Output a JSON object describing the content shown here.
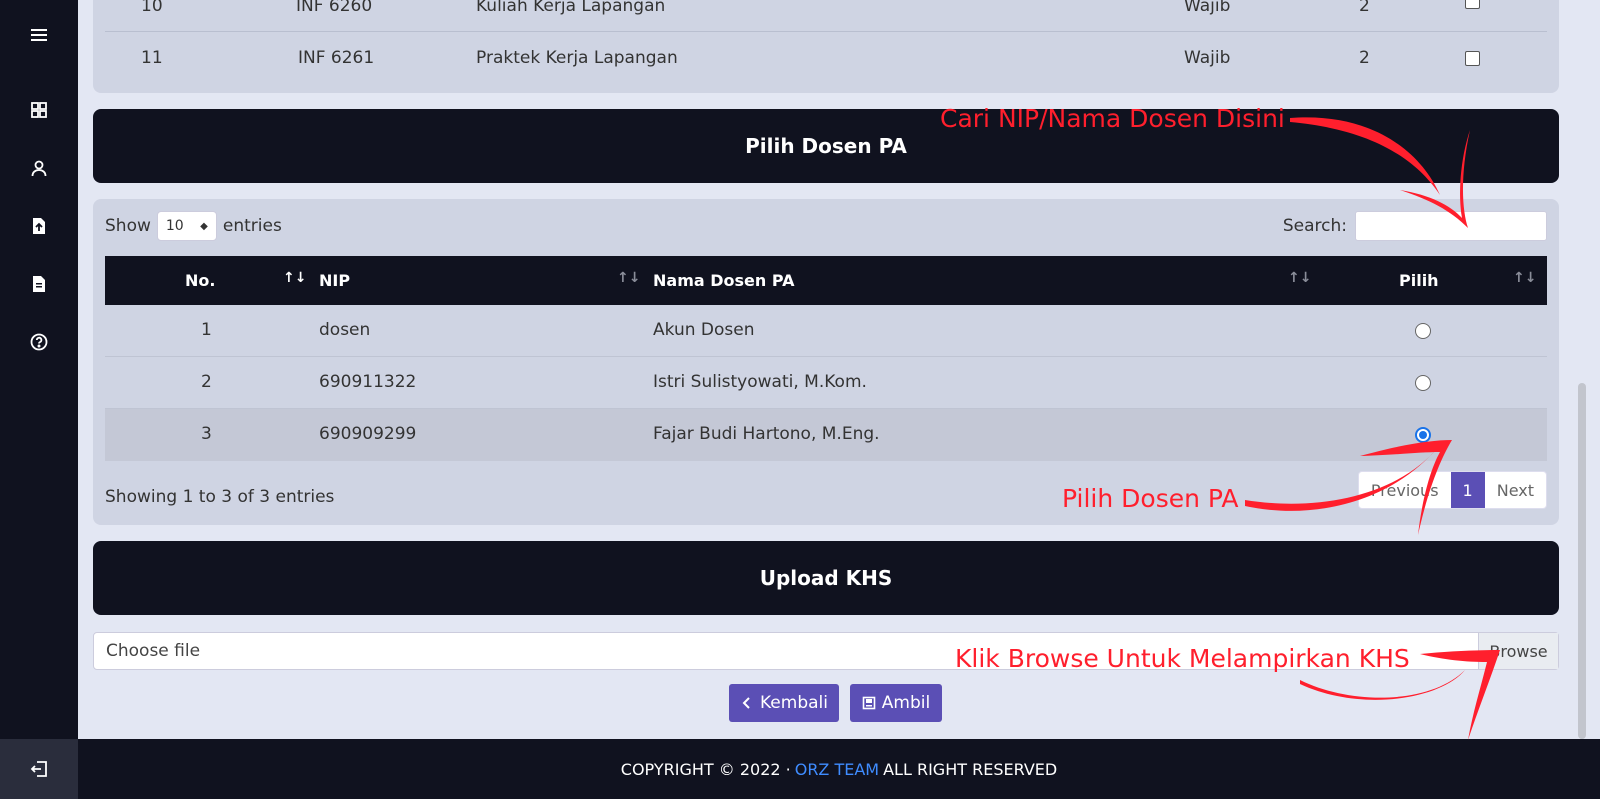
{
  "sidebar": {
    "icons": [
      "menu-icon",
      "dashboard-icon",
      "user-icon",
      "file-upload-icon",
      "document-icon",
      "help-icon",
      "logout-icon"
    ]
  },
  "top_table": {
    "rows": [
      {
        "no": "10",
        "kode": "INF 6260",
        "nama": "Kuliah Kerja Lapangan",
        "sifat": "Wajib",
        "sks": "2"
      },
      {
        "no": "11",
        "kode": "INF 6261",
        "nama": "Praktek Kerja Lapangan",
        "sifat": "Wajib",
        "sks": "2"
      }
    ]
  },
  "dosen_section": {
    "title": "Pilih Dosen PA",
    "show_label": "Show",
    "entries_value": "10",
    "entries_label": "entries",
    "search_label": "Search:",
    "search_placeholder": "",
    "columns": [
      "No.",
      "NIP",
      "Nama Dosen PA",
      "Pilih"
    ],
    "rows": [
      {
        "no": "1",
        "nip": "dosen",
        "nama": "Akun Dosen",
        "selected": false
      },
      {
        "no": "2",
        "nip": "690911322",
        "nama": "Istri Sulistyowati, M.Kom.",
        "selected": false
      },
      {
        "no": "3",
        "nip": "690909299",
        "nama": "Fajar Budi Hartono, M.Eng.",
        "selected": true
      }
    ],
    "info": "Showing 1 to 3 of 3 entries",
    "pager": {
      "previous": "Previous",
      "current": "1",
      "next": "Next"
    }
  },
  "upload_section": {
    "title": "Upload KHS",
    "file_label": "Choose file",
    "browse_label": "Browse"
  },
  "actions": {
    "back_label": "Kembali",
    "take_label": "Ambil"
  },
  "footer": {
    "prefix": "COPYRIGHT © 2022 ·",
    "brand": "ORZ TEAM",
    "suffix": "ALL RIGHT RESERVED"
  },
  "annotations": {
    "search_hint": "Cari NIP/Nama Dosen Disini",
    "select_hint": "Pilih Dosen PA",
    "browse_hint": "Klik Browse Untuk Melampirkan KHS"
  },
  "colors": {
    "sidebar": "#10121f",
    "accent": "#5b4fb5",
    "annotation": "#ff1f2d",
    "brand_link": "#3f8cff"
  }
}
